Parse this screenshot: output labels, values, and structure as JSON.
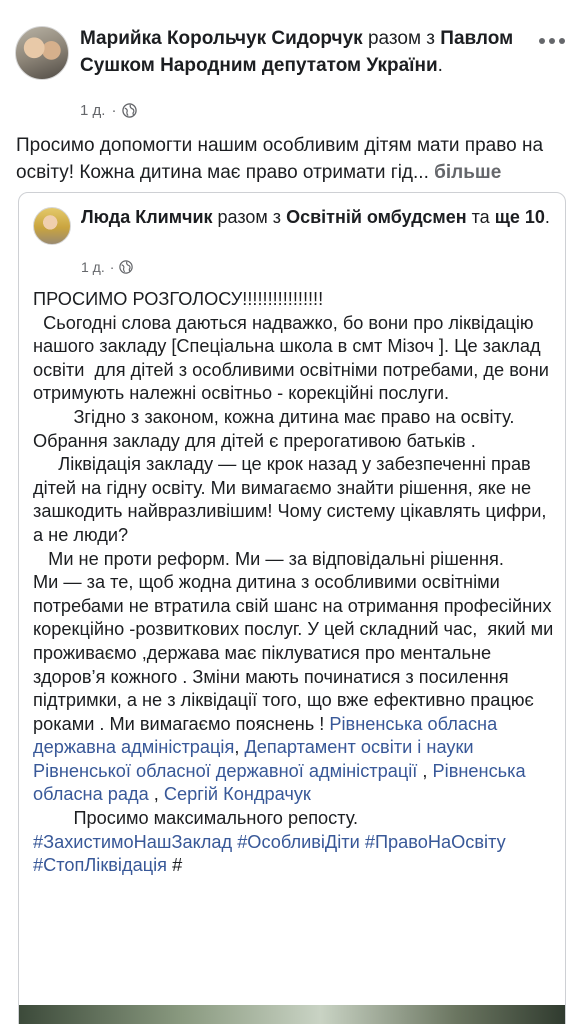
{
  "post": {
    "author": "Марийка Корольчук Сидорчук",
    "with_word": "разом з",
    "tagged": "Павлом Сушком Народним депутатом України",
    "period": ".",
    "time": "1 д.",
    "dot": "·",
    "text": "Просимо допомогти нашим особливим дітям мати право на освіту! Кожна дитина має право отримати гід...",
    "see_more": "більше"
  },
  "shared": {
    "author": "Люда Климчик",
    "with_word": "разом з",
    "tagged": "Освітній омбудсмен",
    "and_word": "та",
    "others": "ще 10",
    "period": ".",
    "time": "1 д.",
    "dot": "·",
    "p1": "ПРОСИМО РОЗГОЛОСУ!!!!!!!!!!!!!!!!",
    "p2": "  Сьогодні слова даються надважко, бо вони про ліквідацію нашого закладу [Спеціальна школа в смт Мізоч ]. Це заклад освіти  для дітей з особливими освітніми потребами, де вони отримують належні освітньо - корекційні послуги.",
    "p3": "        Згідно з законом, кожна дитина має право на освіту. Обрання закладу для дітей є прерогативою батьків .",
    "p4": "     Ліквідація закладу — це крок назад у забезпеченні прав дітей на гідну освіту. Ми вимагаємо знайти рішення, яке не зашкодить найвразливішим! Чому систему цікавлять цифри, а не люди?",
    "p5": "   Ми не проти реформ. Ми — за відповідальні рішення.",
    "p6": "Ми — за те, щоб жодна дитина з особливими освітніми потребами не втратила свій шанс на отримання професійних корекційно -розвиткових послуг. У цей складний час,  який ми проживаємо ,держава має піклуватися про ментальне здоров’я кожного . Зміни мають починатися з посилення підтримки, а не з ліквідації того, що вже ефективно працює роками . Ми вимагаємо пояснень !",
    "mention1": "Рівненська обласна державна адміністрація",
    "sep1": ",",
    "mention2": "Департамент освіти і науки Рівненської обласної державної адміністрації",
    "sep2": " ,",
    "mention3": "Рівненська обласна рада",
    "sep3": " ,",
    "mention4": "Сергій Кондрачук",
    "p7": "        Просимо максимального репосту.",
    "tag1": "#ЗахистимоНашЗаклад",
    "tag2": "#ОсобливіДіти",
    "tag3": "#ПравоНаОсвіту",
    "tag4": "#СтопЛіквідація",
    "tag_end": "#"
  },
  "icons": {
    "globe": "globe-icon",
    "more": "more-options-icon"
  },
  "colors": {
    "link": "#385898",
    "meta": "#65676b",
    "text": "#1c1e21"
  }
}
